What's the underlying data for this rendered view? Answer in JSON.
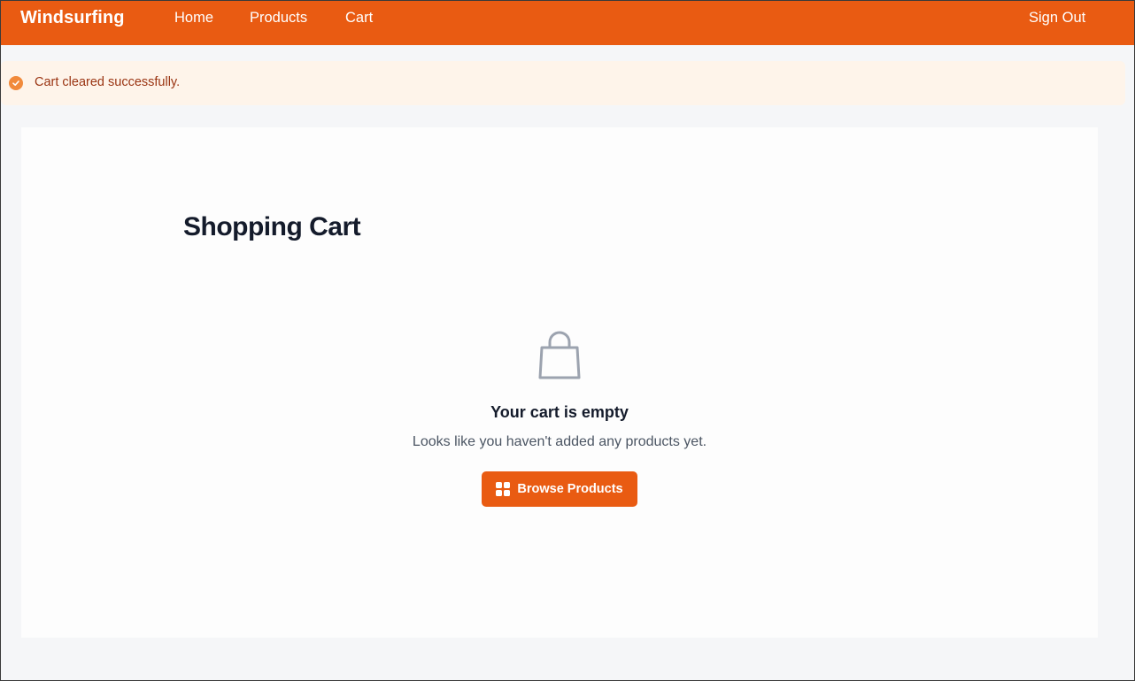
{
  "navbar": {
    "brand": "Windsurfing",
    "links": [
      {
        "label": "Home"
      },
      {
        "label": "Products"
      },
      {
        "label": "Cart"
      }
    ],
    "sign_out": "Sign Out",
    "color": "#e95b12"
  },
  "alert": {
    "message": "Cart cleared successfully.",
    "icon": "check-circle-icon",
    "background": "#fef4ea",
    "text_color": "#9a3412"
  },
  "cart": {
    "title": "Shopping Cart",
    "empty_icon": "shopping-bag-icon",
    "empty_title": "Your cart is empty",
    "empty_message": "Looks like you haven't added any products yet.",
    "browse_button": {
      "label": "Browse Products",
      "icon": "grid-icon",
      "color": "#e95b12"
    }
  }
}
